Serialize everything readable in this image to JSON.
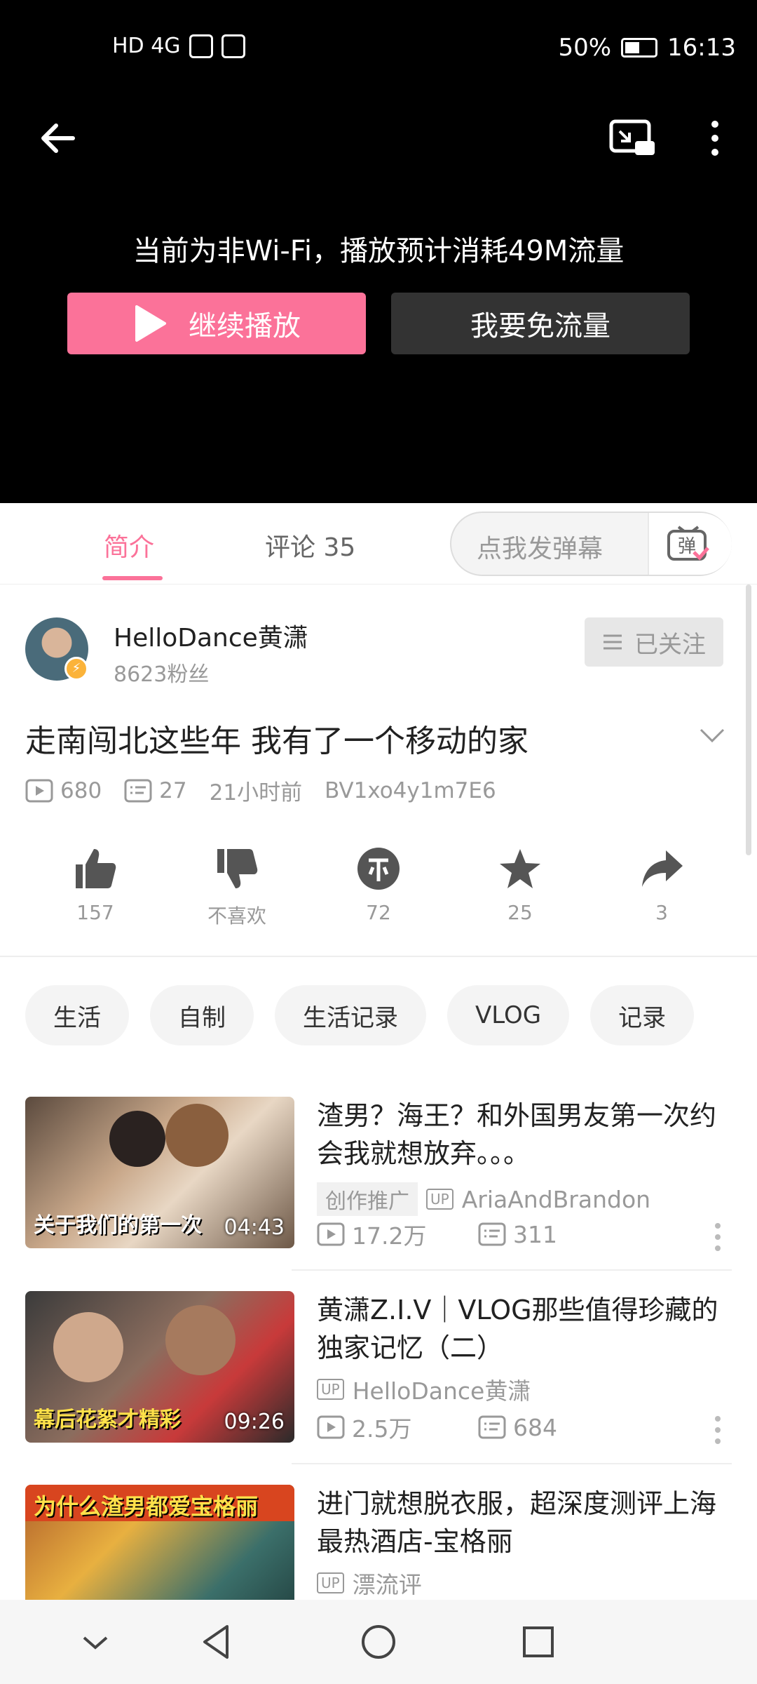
{
  "status_bar": {
    "left_icons": "HD 4G",
    "battery": "50%",
    "time": "16:13"
  },
  "player": {
    "notice": "当前为非Wi-Fi，播放预计消耗49M流量",
    "continue_label": "继续播放",
    "free_data_label": "我要免流量"
  },
  "tabs": {
    "intro": "简介",
    "comments": "评论 35",
    "danmaku_placeholder": "点我发弹幕"
  },
  "uploader": {
    "name": "HelloDance黄潇",
    "fans": "8623粉丝",
    "follow_label": "已关注"
  },
  "video": {
    "title": "走南闯北这些年 我有了一个移动的家",
    "views": "680",
    "danmaku_count": "27",
    "time": "21小时前",
    "bvid": "BV1xo4y1m7E6"
  },
  "actions": {
    "like": "157",
    "dislike": "不喜欢",
    "coin": "72",
    "favorite": "25",
    "share": "3"
  },
  "tags": [
    "生活",
    "自制",
    "生活记录",
    "VLOG",
    "记录"
  ],
  "related": [
    {
      "title": "渣男？海王？和外国男友第一次约会我就想放弃。。。",
      "promo": "创作推广",
      "uploader": "AriaAndBrandon",
      "views": "17.2万",
      "danmaku": "311",
      "duration": "04:43",
      "thumb_caption": "关于我们的第一次"
    },
    {
      "title": "黄潇Z.I.V｜VLOG那些值得珍藏的独家记忆（二）",
      "uploader": "HelloDance黄潇",
      "views": "2.5万",
      "danmaku": "684",
      "duration": "09:26",
      "thumb_caption": "幕后花絮才精彩"
    },
    {
      "title": "进门就想脱衣服，超深度测评上海最热酒店-宝格丽",
      "uploader": "漂流评",
      "thumb_caption": "为什么渣男都爱宝格丽"
    }
  ],
  "colors": {
    "accent": "#fb7299",
    "player_bg": "#000000",
    "secondary_text": "#999999"
  }
}
